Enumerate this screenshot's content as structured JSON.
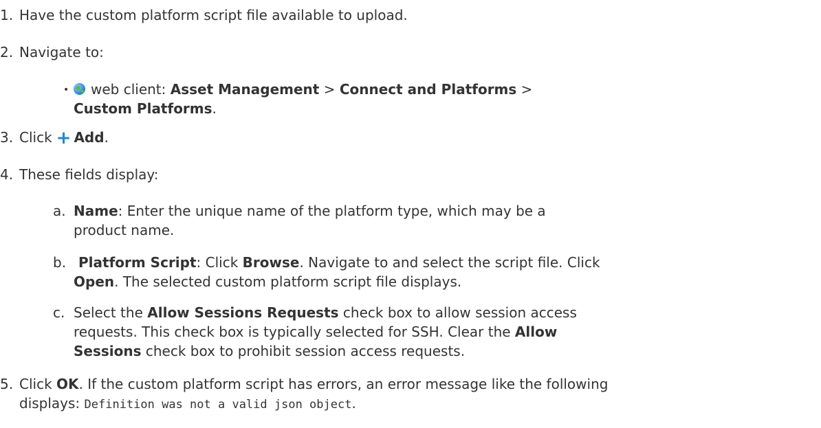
{
  "step1": {
    "num": "1.",
    "text": "Have the custom platform script file available to upload."
  },
  "step2": {
    "num": "2.",
    "text": "Navigate to:",
    "bullet": {
      "icon": "globe-icon",
      "prefix": "web client: ",
      "path1": "Asset Management",
      "sep1": " > ",
      "path2": "Connect and Platforms",
      "sep2": " >",
      "path3": "Custom Platforms",
      "end": "."
    }
  },
  "step3": {
    "num": "3.",
    "prefix": "Click",
    "icon": "plus-icon",
    "label": "Add",
    "end": "."
  },
  "step4": {
    "num": "4.",
    "text": "These fields display:",
    "items": [
      {
        "letter": "a.",
        "bold": "Name",
        "line1": ": Enter the unique name of the platform type, which may be a",
        "line2": "product name."
      },
      {
        "letter": "b.",
        "bold": "Platform Script",
        "mid1": ": Click ",
        "bold2": "Browse",
        "mid2": ". Navigate to and select the script file. Click",
        "bold3": "Open",
        "line2": ". The selected custom platform script file displays."
      },
      {
        "letter": "c.",
        "pre": "Select the ",
        "bold": "Allow Sessions Requests",
        "line1": " check box to allow session access",
        "line2a": "requests. This check box is typically selected for SSH. Clear the ",
        "bold2": "Allow",
        "bold3": "Sessions",
        "line3": " check box to prohibit session access requests."
      }
    ]
  },
  "step5": {
    "num": "5.",
    "pre": "Click ",
    "bold": "OK",
    "line1": ". If the custom platform script has errors, an error message like the following",
    "line2": "displays: ",
    "code": "Definition was not a valid json object",
    "end": "."
  }
}
